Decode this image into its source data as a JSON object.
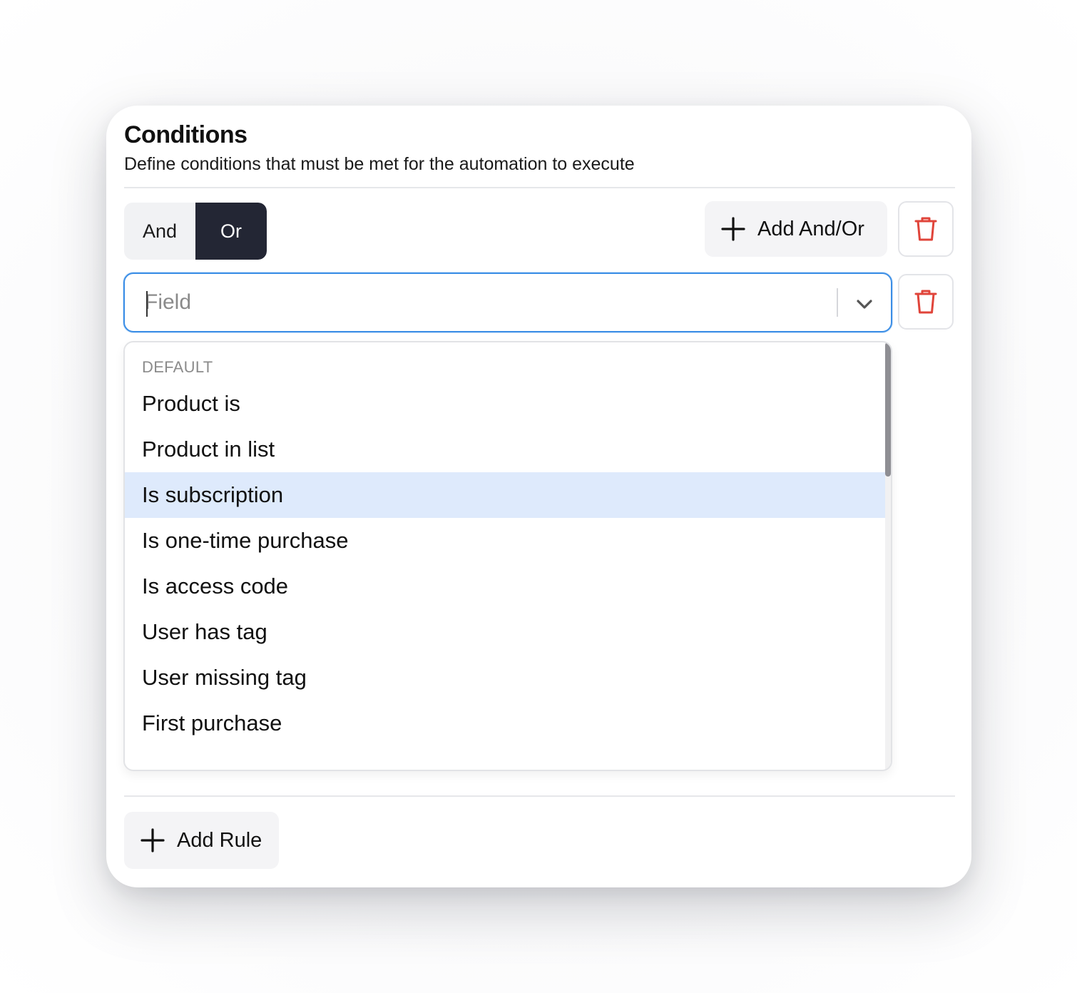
{
  "conditions": {
    "title": "Conditions",
    "subtitle": "Define conditions that must be met for the automation to execute"
  },
  "logic_toggle": {
    "options": [
      "And",
      "Or"
    ],
    "selected": "Or"
  },
  "toolbar": {
    "add_andor_label": "Add And/Or",
    "add_rule_label": "Add Rule"
  },
  "field_select": {
    "placeholder": "Field",
    "value": ""
  },
  "dropdown": {
    "group_label": "DEFAULT",
    "options": [
      "Product is",
      "Product in list",
      "Is subscription",
      "Is one-time purchase",
      "Is access code",
      "User has tag",
      "User missing tag",
      "First purchase"
    ],
    "highlighted": "Is subscription"
  },
  "colors": {
    "accent_focus": "#3b8ee6",
    "toggle_active": "#232634",
    "danger": "#e0443a",
    "highlight": "#deeafc"
  },
  "icons": {
    "plus": "plus-icon",
    "trash": "trash-icon",
    "chevron": "chevron-down-icon"
  }
}
